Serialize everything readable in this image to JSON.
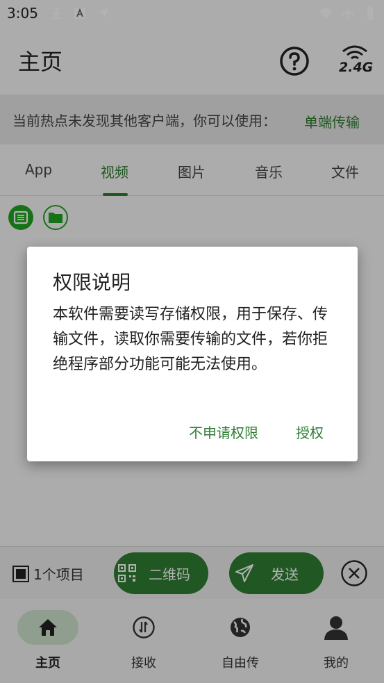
{
  "status_bar": {
    "time": "3:05"
  },
  "app_bar": {
    "title": "主页",
    "wifi_band_label": "2.4G"
  },
  "hint": {
    "text": "当前热点未发现其他客户端，你可以使用：",
    "link": "单端传输"
  },
  "tabs": [
    {
      "label": "App"
    },
    {
      "label": "视频"
    },
    {
      "label": "图片"
    },
    {
      "label": "音乐"
    },
    {
      "label": "文件"
    }
  ],
  "active_tab": "视频",
  "action_bar": {
    "count_label": "1个项目",
    "qr_label": "二维码",
    "send_label": "发送"
  },
  "bottom_nav": [
    {
      "label": "主页",
      "icon": "home-icon"
    },
    {
      "label": "接收",
      "icon": "receive-icon"
    },
    {
      "label": "自由传",
      "icon": "globe-icon"
    },
    {
      "label": "我的",
      "icon": "person-icon"
    }
  ],
  "dialog": {
    "title": "权限说明",
    "body": "本软件需要读写存储权限，用于保存、传输文件，读取你需要传输的文件，若你拒绝程序部分功能可能无法使用。",
    "negative": "不申请权限",
    "positive": "授权"
  },
  "colors": {
    "accent": "#2e7d32",
    "accent_bright": "#22a322",
    "nav_active_bg": "#cfe3cf"
  }
}
